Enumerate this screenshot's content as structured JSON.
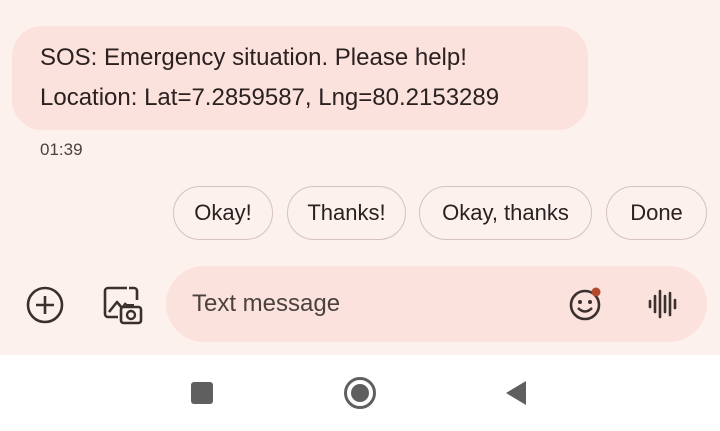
{
  "message": {
    "line1": "SOS: Emergency situation. Please help!",
    "line2": "Location: Lat=7.2859587, Lng=80.2153289",
    "time": "01:39"
  },
  "smart_replies": [
    "Okay!",
    "Thanks!",
    "Okay, thanks",
    "Done"
  ],
  "compose": {
    "placeholder": "Text message",
    "value": ""
  },
  "icons": {
    "add": "add-circle-icon",
    "gallery": "gallery-camera-icon",
    "emoji": "emoji-icon",
    "voice": "voice-waveform-icon",
    "recents": "recents-square-icon",
    "home": "home-circle-icon",
    "back": "back-triangle-icon"
  },
  "colors": {
    "background": "#fdf1ee",
    "bubble": "#fbe2dd",
    "text": "#2a2120",
    "emoji_dot": "#b5492e"
  }
}
